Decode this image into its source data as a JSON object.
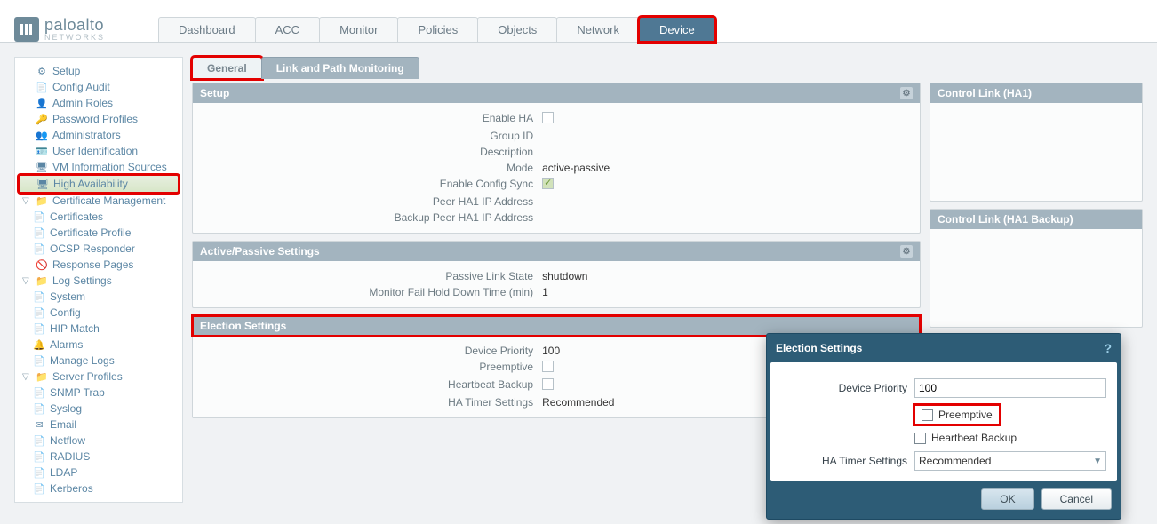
{
  "brand": {
    "part1": "paloalto",
    "part2": "NETWORKS"
  },
  "top_tabs": [
    "Dashboard",
    "ACC",
    "Monitor",
    "Policies",
    "Objects",
    "Network",
    "Device"
  ],
  "top_tab_active": "Device",
  "sidebar": [
    {
      "label": "Setup",
      "icon": "⚙"
    },
    {
      "label": "Config Audit",
      "icon": "📄"
    },
    {
      "label": "Admin Roles",
      "icon": "👤"
    },
    {
      "label": "Password Profiles",
      "icon": "🔑"
    },
    {
      "label": "Administrators",
      "icon": "👥"
    },
    {
      "label": "User Identification",
      "icon": "🪪"
    },
    {
      "label": "VM Information Sources",
      "icon": "🖥"
    },
    {
      "label": "High Availability",
      "icon": "🖥",
      "selected": true
    },
    {
      "label": "Certificate Management",
      "icon": "📁",
      "children": [
        {
          "label": "Certificates",
          "icon": "📄"
        },
        {
          "label": "Certificate Profile",
          "icon": "📄"
        },
        {
          "label": "OCSP Responder",
          "icon": "📄"
        }
      ]
    },
    {
      "label": "Response Pages",
      "icon": "🚫"
    },
    {
      "label": "Log Settings",
      "icon": "📁",
      "children": [
        {
          "label": "System",
          "icon": "📄"
        },
        {
          "label": "Config",
          "icon": "📄"
        },
        {
          "label": "HIP Match",
          "icon": "📄"
        },
        {
          "label": "Alarms",
          "icon": "🔔"
        },
        {
          "label": "Manage Logs",
          "icon": "📄"
        }
      ]
    },
    {
      "label": "Server Profiles",
      "icon": "📁",
      "children": [
        {
          "label": "SNMP Trap",
          "icon": "📄"
        },
        {
          "label": "Syslog",
          "icon": "📄"
        },
        {
          "label": "Email",
          "icon": "✉"
        },
        {
          "label": "Netflow",
          "icon": "📄"
        },
        {
          "label": "RADIUS",
          "icon": "📄"
        },
        {
          "label": "LDAP",
          "icon": "📄"
        },
        {
          "label": "Kerberos",
          "icon": "📄"
        }
      ]
    }
  ],
  "subtabs": {
    "active": "General",
    "other": "Link and Path Monitoring"
  },
  "setup_panel": {
    "title": "Setup",
    "rows": [
      {
        "k": "Enable HA",
        "type": "cb",
        "checked": false
      },
      {
        "k": "Group ID",
        "v": ""
      },
      {
        "k": "Description",
        "v": ""
      },
      {
        "k": "Mode",
        "v": "active-passive"
      },
      {
        "k": "Enable Config Sync",
        "type": "cb",
        "checked": true
      },
      {
        "k": "Peer HA1 IP Address",
        "v": ""
      },
      {
        "k": "Backup Peer HA1 IP Address",
        "v": ""
      }
    ]
  },
  "ap_panel": {
    "title": "Active/Passive Settings",
    "rows": [
      {
        "k": "Passive Link State",
        "v": "shutdown"
      },
      {
        "k": "Monitor Fail Hold Down Time (min)",
        "v": "1"
      }
    ]
  },
  "election_panel": {
    "title": "Election Settings",
    "rows": [
      {
        "k": "Device Priority",
        "v": "100"
      },
      {
        "k": "Preemptive",
        "type": "cb",
        "checked": false
      },
      {
        "k": "Heartbeat Backup",
        "type": "cb",
        "checked": false
      },
      {
        "k": "HA Timer Settings",
        "v": "Recommended"
      }
    ]
  },
  "right_panels": [
    {
      "title": "Control Link (HA1)"
    },
    {
      "title": "Control Link (HA1 Backup)"
    }
  ],
  "dialog": {
    "title": "Election Settings",
    "device_priority": "100",
    "preemptive_label": "Preemptive",
    "heartbeat_label": "Heartbeat Backup",
    "timer_label": "HA Timer Settings",
    "timer_value": "Recommended",
    "ok": "OK",
    "cancel": "Cancel",
    "device_priority_label": "Device Priority"
  }
}
